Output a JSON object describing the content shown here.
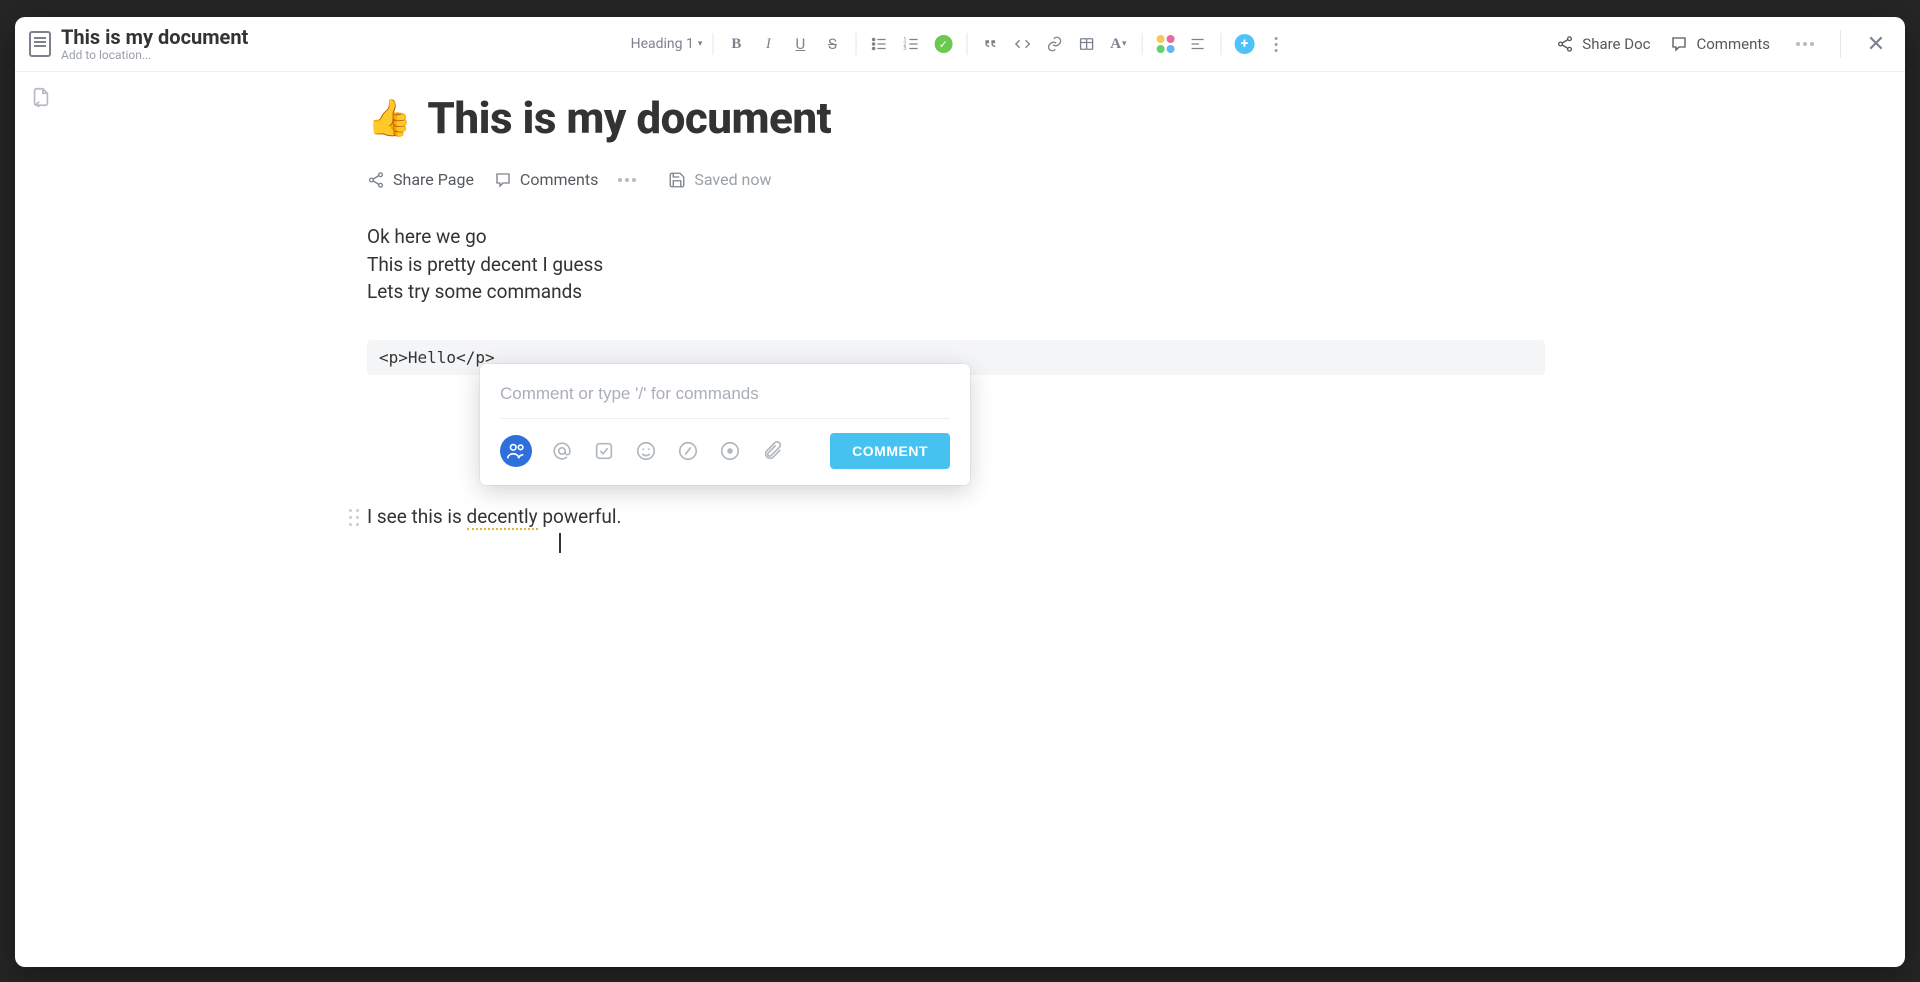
{
  "header": {
    "title": "This is my document",
    "location_placeholder": "Add to location...",
    "heading_select": "Heading 1",
    "share_doc": "Share Doc",
    "comments": "Comments"
  },
  "document": {
    "emoji": "👍",
    "title": "This is my document",
    "share_page": "Share Page",
    "comments": "Comments",
    "saved": "Saved now",
    "body_lines": [
      "Ok here we go",
      "This is pretty decent I guess",
      "Lets try some commands"
    ],
    "code_block": "<p>Hello</p>",
    "para2_pre": "I see this is ",
    "para2_mark": "decently",
    "para2_post": " powerful."
  },
  "popover": {
    "placeholder": "Comment or type '/' for commands",
    "submit": "COMMENT"
  }
}
